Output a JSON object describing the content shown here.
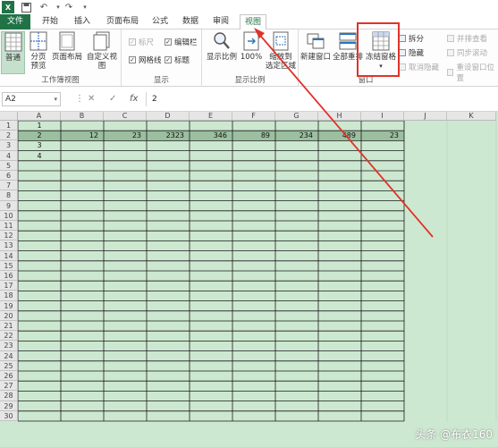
{
  "quick_access": {
    "icons": [
      "excel-logo-icon",
      "save-icon",
      "undo-icon",
      "redo-icon",
      "customize-icon"
    ]
  },
  "tabs": [
    {
      "label": "文件",
      "active": false,
      "file": true
    },
    {
      "label": "开始",
      "active": false
    },
    {
      "label": "插入",
      "active": false
    },
    {
      "label": "页面布局",
      "active": false
    },
    {
      "label": "公式",
      "active": false
    },
    {
      "label": "数据",
      "active": false
    },
    {
      "label": "审阅",
      "active": false
    },
    {
      "label": "视图",
      "active": true
    }
  ],
  "ribbon": {
    "workbook_views": {
      "label": "工作簿视图",
      "normal": "普通",
      "page_break": "分页\n预览",
      "page_layout": "页面布局",
      "custom_views": "自定义视图"
    },
    "show": {
      "label": "显示",
      "ruler": "标尺",
      "formula_bar": "编辑栏",
      "gridlines": "网格线",
      "headings": "标题"
    },
    "zoom": {
      "label": "显示比例",
      "zoom": "显示比例",
      "zoom100": "100%",
      "zoom_selection": "缩放到\n选定区域"
    },
    "window": {
      "label": "窗口",
      "new_window": "新建窗口",
      "arrange_all": "全部重排",
      "freeze_panes": "冻结窗格",
      "split": "拆分",
      "hide": "隐藏",
      "unhide": "取消隐藏",
      "view_side": "并排查看",
      "sync_scroll": "同步滚动",
      "reset_pos": "重设窗口位置"
    }
  },
  "formula_bar": {
    "name_box": "A2",
    "cancel": "✕",
    "enter": "✓",
    "fx": "fx",
    "value": "2"
  },
  "columns": [
    "A",
    "B",
    "C",
    "D",
    "E",
    "F",
    "G",
    "H",
    "I",
    "J",
    "K"
  ],
  "rows": [
    "1",
    "2",
    "3",
    "4",
    "5",
    "6",
    "7",
    "8",
    "9",
    "10",
    "11",
    "12",
    "13",
    "14",
    "15",
    "16",
    "17",
    "18",
    "19",
    "20",
    "21",
    "22",
    "23",
    "24",
    "25",
    "26",
    "27",
    "28",
    "29",
    "30"
  ],
  "cells": {
    "A1": "1",
    "A2": "2",
    "A3": "3",
    "A4": "4",
    "B2": "12",
    "C2": "23",
    "D2": "2323",
    "E2": "346",
    "F2": "89",
    "G2": "234",
    "H2": "489",
    "I2": "23"
  },
  "watermark": "头条 @布衣160",
  "colors": {
    "excel_green": "#217346",
    "annotation_red": "#e0322a",
    "sheet_tint": "#cde8d0"
  }
}
